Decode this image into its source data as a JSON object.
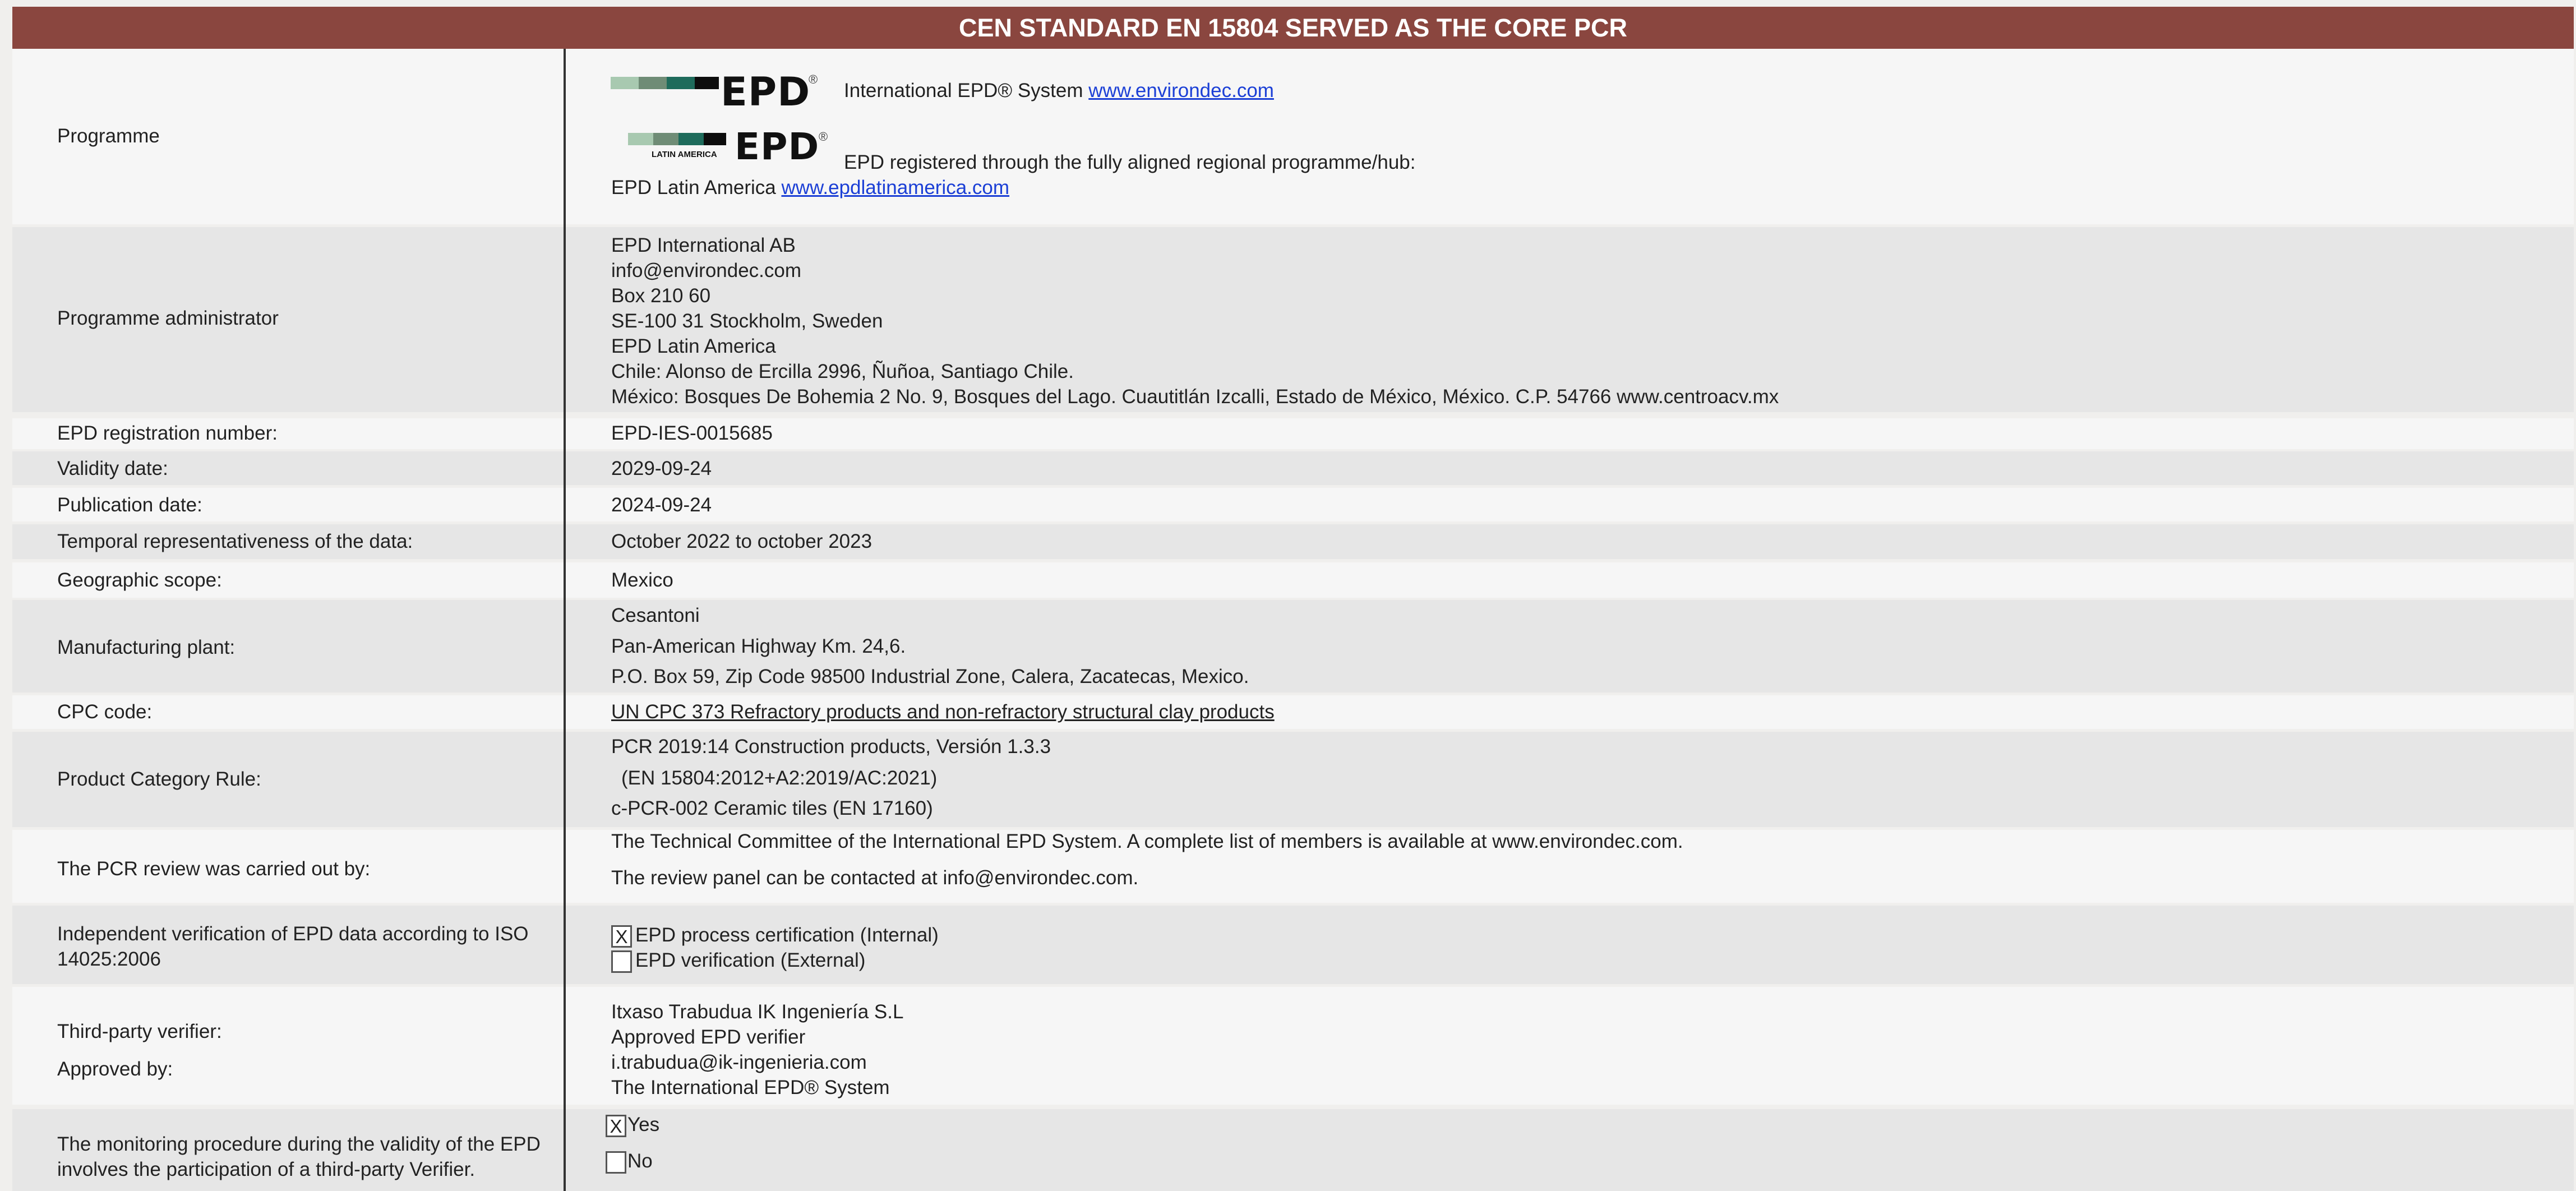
{
  "header": {
    "title": "CEN STANDARD EN 15804 SERVED AS THE CORE PCR"
  },
  "programme": {
    "label": "Programme",
    "logo1_text": "EPD",
    "logo1_reg": "®",
    "line1_text": "International EPD® System ",
    "line1_link": "www.environdec.com",
    "logo2_text": "EPD",
    "logo2_reg": "®",
    "logo2_sub": "LATIN AMERICA",
    "line2_text": "EPD registered through the fully aligned regional programme/hub:",
    "line3_text": "EPD Latin America ",
    "line3_link": "www.epdlatinamerica.com"
  },
  "admin": {
    "label": "Programme administrator",
    "lines": [
      "EPD International AB",
      "info@environdec.com",
      "Box 210 60",
      "SE-100 31 Stockholm, Sweden",
      "EPD Latin America",
      "Chile:  Alonso de Ercilla 2996, Ñuñoa, Santiago Chile.",
      "México:  Bosques De Bohemia 2 No. 9, Bosques del Lago. Cuautitlán Izcalli, Estado de México, México. C.P. 54766 www.centroacv.mx"
    ]
  },
  "registration": {
    "label": "EPD registration number:",
    "value": "EPD-IES-0015685"
  },
  "validity": {
    "label": "Validity date:",
    "value": "2029-09-24"
  },
  "publication": {
    "label": "Publication date:",
    "value": "2024-09-24"
  },
  "temporal": {
    "label": "Temporal representativeness of the data:",
    "value": "October 2022 to october 2023"
  },
  "geographic": {
    "label": "Geographic scope:",
    "value": "Mexico"
  },
  "plant": {
    "label": "Manufacturing plant:",
    "lines": [
      "Cesantoni",
      "Pan-American Highway Km. 24,6.",
      "P.O. Box 59, Zip Code 98500 Industrial Zone, Calera, Zacatecas, Mexico."
    ]
  },
  "cpc": {
    "label": "CPC code:",
    "value": "UN CPC 373 Refractory products and non-refractory structural clay products"
  },
  "pcr": {
    "label": "Product Category Rule:",
    "lines": [
      "PCR 2019:14 Construction products, Versión 1.3.3",
      "(EN 15804:2012+A2:2019/AC:2021)",
      "c-PCR-002 Ceramic tiles (EN 17160)"
    ]
  },
  "review": {
    "label": "The PCR review was carried out by:",
    "lines": [
      "The Technical Committee of the International EPD System. A complete list of members is available at www.environdec.com.",
      "The review panel can be contacted at info@environdec.com."
    ]
  },
  "verification": {
    "label": "Independent verification of EPD data according to ISO 14025:2006",
    "options": [
      {
        "mark": "X",
        "text": "EPD process certification (Internal)"
      },
      {
        "mark": "",
        "text": "EPD verification (External)"
      }
    ]
  },
  "verifier": {
    "label1": "Third-party verifier:",
    "label2": "Approved by:",
    "lines": [
      "Itxaso Trabudua IK Ingeniería S.L",
      "Approved EPD verifier",
      "i.trabudua@ik-ingenieria.com",
      "The International EPD® System"
    ]
  },
  "monitoring": {
    "label": "The monitoring procedure during the validity of the EPD involves the participation of a third-party Verifier.",
    "options": [
      {
        "mark": "X",
        "text": "Yes"
      },
      {
        "mark": "",
        "text": "No"
      }
    ]
  },
  "colors": {
    "header_bg": "#8a463f",
    "link": "#1b3fd6",
    "row_light": "#f6f6f6",
    "row_dark": "#e6e6e6"
  }
}
